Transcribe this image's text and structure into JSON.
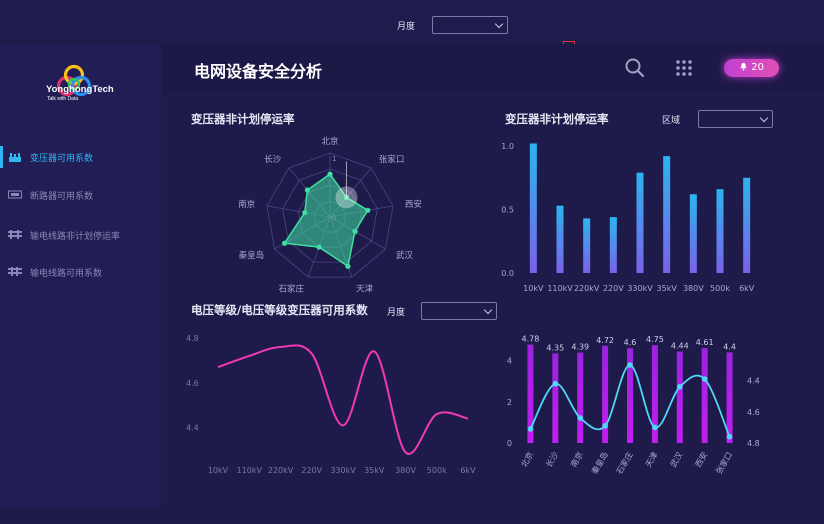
{
  "filters": {
    "month_label": "月度",
    "region_label": "区域",
    "voltage_month_label": "月度"
  },
  "app": {
    "brand_name": "YonghongTech",
    "brand_tagline": "Talk with Data"
  },
  "sidebar": {
    "items": [
      {
        "label": "变压器可用系数",
        "icon": "transformer-icon",
        "active": true
      },
      {
        "label": "断路器可用系数",
        "icon": "breaker-icon",
        "active": false
      },
      {
        "label": "输电线路非计划停运率",
        "icon": "line-outage-icon",
        "active": false
      },
      {
        "label": "输电线路可用系数",
        "icon": "line-availability-icon",
        "active": false
      }
    ]
  },
  "header": {
    "title": "电网设备安全分析",
    "notification_count": "20"
  },
  "colors": {
    "accent": "#31b6f4",
    "radar": "#3ee0a0",
    "pink": "#f03ab4",
    "purple": "#b820e8",
    "line": "#4fd8f4"
  },
  "chart_data": [
    {
      "type": "radar",
      "title": "变压器非计划停运率",
      "categories": [
        "北京",
        "张家口",
        "西安",
        "武汉",
        "天津",
        "石家庄",
        "秦皇岛",
        "南京",
        "长沙"
      ],
      "values": [
        0.67,
        0.4,
        0.6,
        0.45,
        0.82,
        0.5,
        0.82,
        0.4,
        0.55
      ],
      "range": [
        0,
        1
      ],
      "tick_labels": [
        "0",
        "1"
      ]
    },
    {
      "type": "bar",
      "title": "变压器非计划停运率",
      "categories": [
        "10kV",
        "110kV",
        "220kV",
        "220V",
        "330kV",
        "35kV",
        "380V",
        "500k",
        "6kV"
      ],
      "values": [
        1.02,
        0.53,
        0.43,
        0.44,
        0.79,
        0.92,
        0.62,
        0.66,
        0.75
      ],
      "ylim": [
        0,
        1.0
      ],
      "y_ticks": [
        "0.0",
        "0.5",
        "1.0"
      ]
    },
    {
      "type": "line",
      "title": "电压等级/电压等级变压器可用系数",
      "categories": [
        "10kV",
        "110kV",
        "220kV",
        "220V",
        "330kV",
        "35kV",
        "380V",
        "500k",
        "6kV"
      ],
      "values": [
        4.67,
        4.72,
        4.76,
        4.73,
        4.41,
        4.74,
        4.29,
        4.46,
        4.44
      ],
      "ylim": [
        4.3,
        4.8
      ],
      "y_ticks": [
        "4.8",
        "4.6",
        "4.4"
      ]
    },
    {
      "type": "bar",
      "title": "",
      "categories": [
        "北京",
        "长沙",
        "南京",
        "秦皇岛",
        "石家庄",
        "天津",
        "武汉",
        "西安",
        "张家口"
      ],
      "bar_values": [
        4.78,
        4.35,
        4.39,
        4.72,
        4.6,
        4.75,
        4.44,
        4.61,
        4.4
      ],
      "bar_labels": [
        "4.78",
        "4.35",
        "4.39",
        "4.72",
        "4.6",
        "4.75",
        "4.44",
        "4.61",
        "4.4"
      ],
      "line_values": [
        4.71,
        4.42,
        4.64,
        4.69,
        4.3,
        4.7,
        4.44,
        4.39,
        4.76
      ],
      "left_ylim": [
        0,
        5
      ],
      "left_ticks": [
        "0",
        "2",
        "4"
      ],
      "right_ylim": [
        4.3,
        4.8
      ],
      "right_ticks": [
        "4.4",
        "4.6",
        "4.8"
      ]
    }
  ]
}
